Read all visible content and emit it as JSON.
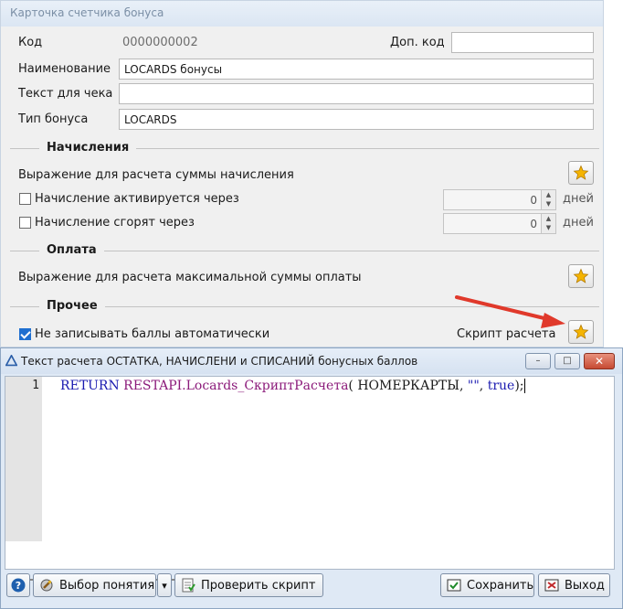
{
  "card": {
    "title": "Карточка счетчика бонуса",
    "code_label": "Код",
    "code_value": "0000000002",
    "extra_code_label": "Доп. код",
    "extra_code_value": "",
    "name_label": "Наименование",
    "name_value": "LOCARDS бонусы",
    "receipt_text_label": "Текст для чека",
    "receipt_text_value": "",
    "bonus_type_label": "Тип бонуса",
    "bonus_type_value": "LOCARDS",
    "accruals": {
      "title": "Начисления",
      "expression_label": "Выражение для расчета суммы начисления",
      "activates_label": "Начисление активируется через",
      "activates_checked": false,
      "activates_value": "0",
      "expires_label": "Начисление сгорят  через",
      "expires_checked": false,
      "expires_value": "0",
      "days_unit": "дней"
    },
    "payment": {
      "title": "Оплата",
      "expression_label": "Выражение для расчета максимальной суммы оплаты"
    },
    "other": {
      "title": "Прочее",
      "no_auto_label": "Не записывать баллы автоматически",
      "no_auto_checked": true,
      "script_label": "Скрипт расчета"
    }
  },
  "dialog": {
    "title": "Текст расчета ОСТАТКА, НАЧИСЛЕНИ и СПИСАНИЙ бонусных баллов",
    "line_number": "1",
    "code": {
      "keyword": "RETURN",
      "function": "RESTAPI.Locards_СкриптРасчета",
      "open": "( ",
      "arg1": "НОМЕРКАРТЫ",
      "comma1": ", ",
      "arg2": "\"\"",
      "comma2": ", ",
      "arg3": "true",
      "close": ");"
    },
    "buttons": {
      "help": "?",
      "concept": "Выбор понятия",
      "dropdown": "▾",
      "check": "Проверить скрипт",
      "save": "Сохранить",
      "exit": "Выход"
    },
    "window_buttons": {
      "minimize": "–",
      "maximize": "□",
      "close": "✕"
    }
  },
  "colors": {
    "annotation_arrow": "#e0392b",
    "star": "#f5b400",
    "checkbox_checked": "#1f6fd0"
  },
  "icons": [
    "star-icon",
    "question-icon",
    "concept-icon",
    "check-script-icon",
    "save-icon",
    "exit-icon",
    "app-icon"
  ]
}
